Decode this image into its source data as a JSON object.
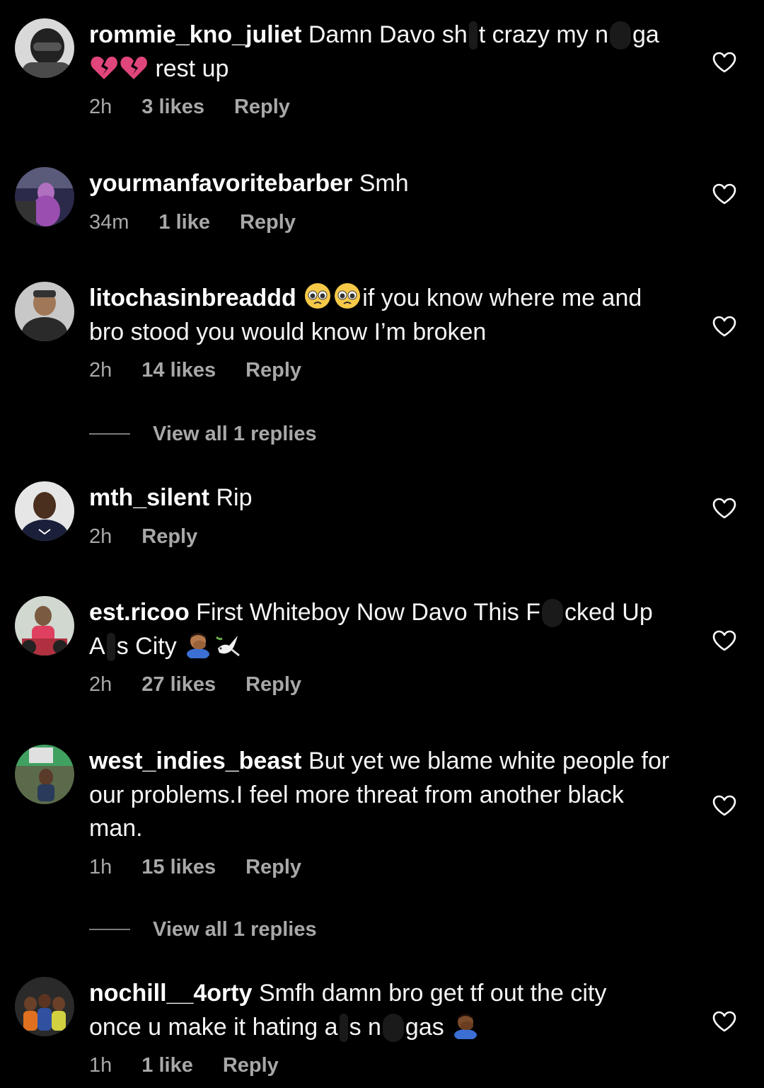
{
  "comments": [
    {
      "username": "rommie_kno_juliet",
      "text_parts": [
        "Damn Davo sh",
        "t crazy my n",
        "ga",
        "rest up"
      ],
      "time": "2h",
      "likes": "3 likes",
      "reply": "Reply",
      "emoji": [
        "broken-heart",
        "broken-heart"
      ]
    },
    {
      "username": "yourmanfavoritebarber",
      "text": "Smh",
      "time": "34m",
      "likes": "1 like",
      "reply": "Reply"
    },
    {
      "username": "litochasinbreaddd",
      "text_parts": [
        "if you know where me and",
        "bro stood you would know I’m broken"
      ],
      "time": "2h",
      "likes": "14 likes",
      "reply": "Reply",
      "emoji": [
        "pleading-face",
        "pleading-face"
      ],
      "view_replies": "View all 1 replies"
    },
    {
      "username": "mth_silent",
      "text": "Rip",
      "time": "2h",
      "reply": "Reply"
    },
    {
      "username": "est.ricoo",
      "text_parts": [
        "First Whiteboy Now Davo This F",
        "cked Up",
        "A",
        "s City"
      ],
      "time": "2h",
      "likes": "27 likes",
      "reply": "Reply",
      "emoji": [
        "man-facepalming",
        "dove"
      ]
    },
    {
      "username": "west_indies_beast",
      "text": "But yet we blame white people for our problems.I feel more threat from another black man.",
      "time": "1h",
      "likes": "15 likes",
      "reply": "Reply",
      "view_replies": "View all 1 replies"
    },
    {
      "username": "nochill__4orty",
      "text_parts": [
        "Smfh damn bro get tf out the city",
        "once u make it hating a",
        "s n",
        "gas"
      ],
      "time": "1h",
      "likes": "1 like",
      "reply": "Reply",
      "emoji": [
        "man-facepalming"
      ]
    }
  ],
  "colors": {
    "background": "#000000",
    "primary_text": "#f5f5f5",
    "secondary_text": "#a8a8a8",
    "broken_heart": "#e0457b"
  },
  "icons": {
    "like": "heart-outline-icon"
  }
}
